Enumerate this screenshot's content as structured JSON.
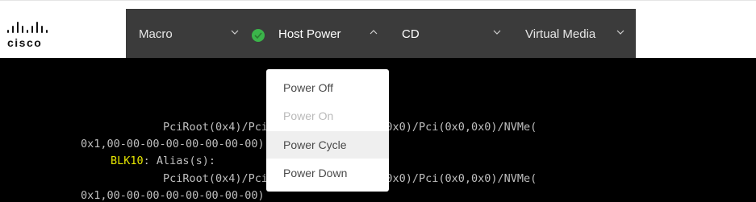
{
  "logo": {
    "text": "cisco"
  },
  "menubar": {
    "items": [
      {
        "label": "Macro",
        "chevron": "down"
      },
      {
        "label": "Host Power",
        "chevron": "up",
        "status_icon": "check-circle-icon",
        "status_color": "#3bb44a"
      },
      {
        "label": "CD",
        "chevron": "down"
      },
      {
        "label": "Virtual Media",
        "chevron": "down"
      }
    ]
  },
  "host_power_menu": {
    "items": [
      {
        "label": "Power Off",
        "enabled": true
      },
      {
        "label": "Power On",
        "enabled": false
      },
      {
        "label": "Power Cycle",
        "enabled": true,
        "hovered": true
      },
      {
        "label": "Power Down",
        "enabled": true
      }
    ]
  },
  "console": {
    "lines": [
      "PciRoot(0x4)/Pci(0x0,0x0)/Pci(0x1,0x0)/Pci(0x0,0x0)/NVMe(",
      "0x1,00-00-00-00-00-00-00-00)",
      "BLK10",
      ": Alias(s):",
      "PciRoot(0x4)/Pci(0x0,0x0)/Pci(0x3,0x0)/Pci(0x0,0x0)/NVMe(",
      "0x1,00-00-00-00-00-00-00-00)"
    ]
  }
}
